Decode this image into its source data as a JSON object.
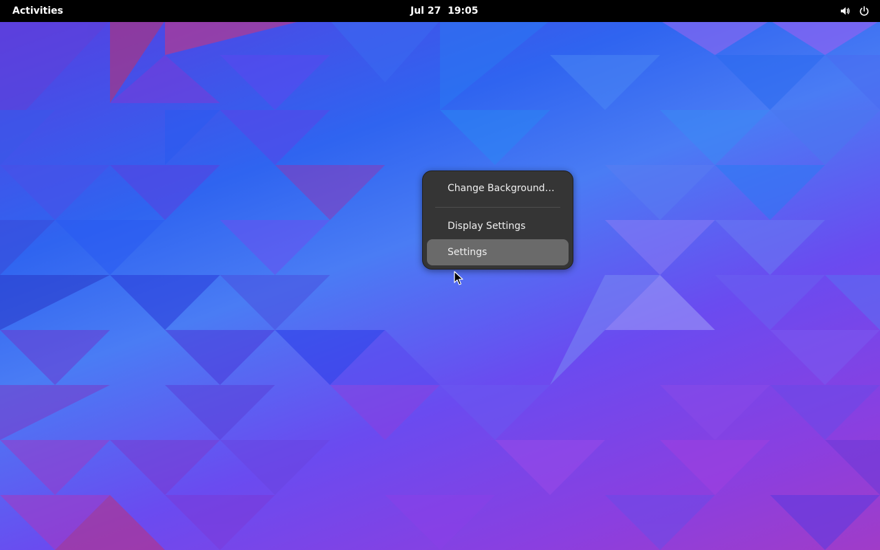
{
  "top_bar": {
    "activities_label": "Activities",
    "clock": "Jul 27  19:05",
    "status_icons": [
      "volume-icon",
      "power-icon"
    ]
  },
  "context_menu": {
    "items": [
      {
        "label": "Change Background…"
      },
      {
        "label": "Display Settings"
      },
      {
        "label": "Settings",
        "hovered": true
      }
    ]
  },
  "colors": {
    "top_bar": "#000000",
    "menu_background": "#353535",
    "menu_item_hover": "#6a6a6a",
    "menu_text": "#f0f0f0"
  }
}
